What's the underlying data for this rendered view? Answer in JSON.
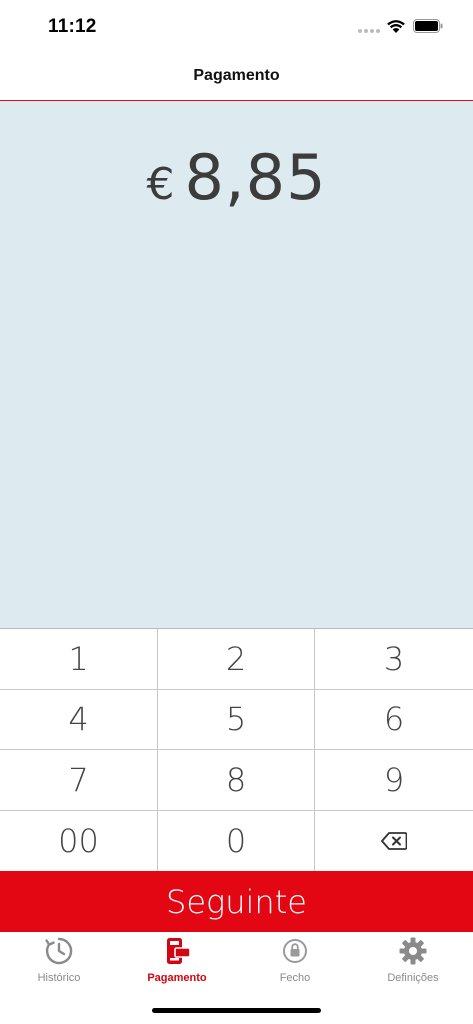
{
  "status": {
    "time": "11:12"
  },
  "nav": {
    "title": "Pagamento"
  },
  "amount": {
    "currency": "€",
    "value": "8,85"
  },
  "keypad": {
    "keys": [
      "1",
      "2",
      "3",
      "4",
      "5",
      "6",
      "7",
      "8",
      "9",
      "00",
      "0"
    ],
    "backspace_icon": "backspace-icon"
  },
  "next_button": {
    "label": "Seguinte"
  },
  "tabs": [
    {
      "label": "Histórico",
      "icon": "history-icon"
    },
    {
      "label": "Pagamento",
      "icon": "payment-terminal-icon",
      "active": true
    },
    {
      "label": "Fecho",
      "icon": "lock-icon"
    },
    {
      "label": "Definições",
      "icon": "gear-icon"
    }
  ],
  "colors": {
    "accent": "#e30613",
    "amount_bg": "#ddebf0",
    "inactive_tab": "#8a8a8a"
  }
}
